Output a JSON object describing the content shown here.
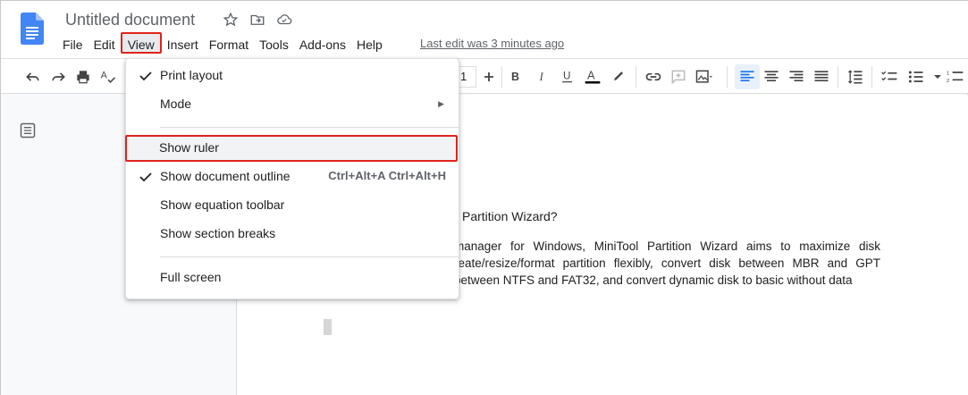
{
  "header": {
    "title": "Untitled document",
    "menus": [
      "File",
      "Edit",
      "View",
      "Insert",
      "Format",
      "Tools",
      "Add-ons",
      "Help"
    ],
    "last_edit": "Last edit was 3 minutes ago"
  },
  "toolbar": {
    "font_size": "1",
    "icons": [
      "undo-icon",
      "redo-icon",
      "print-icon",
      "spellcheck-icon",
      "plus-icon",
      "bold-icon",
      "italic-icon",
      "underline-icon",
      "text-color-icon",
      "highlight-icon",
      "link-icon",
      "comment-icon",
      "image-icon",
      "align-left-icon",
      "align-center-icon",
      "align-right-icon",
      "align-justify-icon",
      "line-spacing-icon",
      "checklist-icon",
      "bulleted-list-icon",
      "numbered-list-icon"
    ],
    "text_color": "#000000",
    "active_align": "left"
  },
  "view_menu": {
    "items": [
      {
        "label": "Print layout",
        "checked": true
      },
      {
        "label": "Mode",
        "submenu": true
      },
      {
        "label": "Show ruler",
        "highlighted": true
      },
      {
        "label": "Show document outline",
        "checked": true,
        "shortcut": "Ctrl+Alt+A Ctrl+Alt+H"
      },
      {
        "label": "Show equation toolbar"
      },
      {
        "label": "Show section breaks"
      },
      {
        "label": "Full screen"
      }
    ]
  },
  "document": {
    "heading": "Partition Wizard?",
    "paragraph": "manager for Windows, MiniTool Partition Wizard aims to maximize disk reate/resize/format partition flexibly, convert disk between MBR and GPT between NTFS and FAT32, and convert dynamic disk to basic without data"
  },
  "colors": {
    "accent_red": "#e0231c",
    "docs_blue": "#4285f4",
    "align_active": "#1a73e8"
  }
}
